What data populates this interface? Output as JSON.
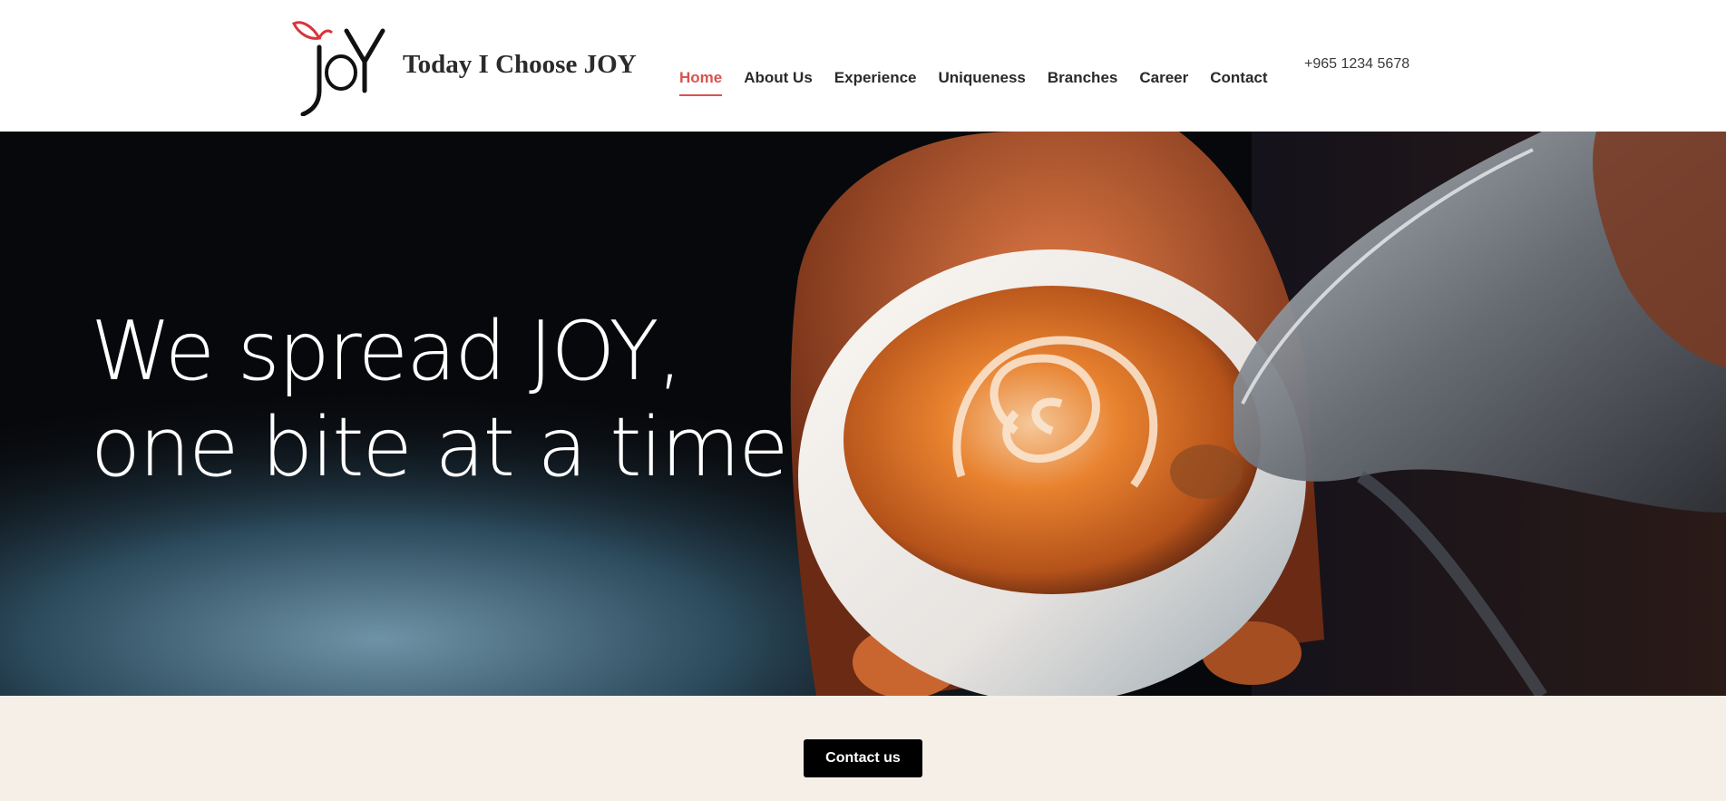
{
  "header": {
    "brand_name": "Today I Choose JOY",
    "logo": {
      "icon": "joy-logo",
      "letters": "JOY",
      "accent_color": "#d9343a"
    },
    "nav": [
      {
        "label": "Home",
        "active": true
      },
      {
        "label": "About Us",
        "active": false
      },
      {
        "label": "Experience",
        "active": false
      },
      {
        "label": "Uniqueness",
        "active": false
      },
      {
        "label": "Branches",
        "active": false
      },
      {
        "label": "Career",
        "active": false
      },
      {
        "label": "Contact",
        "active": false
      }
    ],
    "phone": "+965 1234 5678"
  },
  "hero": {
    "headline_line1": "We spread JOY,",
    "headline_line2": "one bite at a time",
    "image": "latte-art-pour"
  },
  "cta": {
    "contact_label": "Contact us"
  },
  "colors": {
    "accent": "#d9534f",
    "cta_band_bg": "#f5efe7",
    "button_bg": "#000000"
  }
}
